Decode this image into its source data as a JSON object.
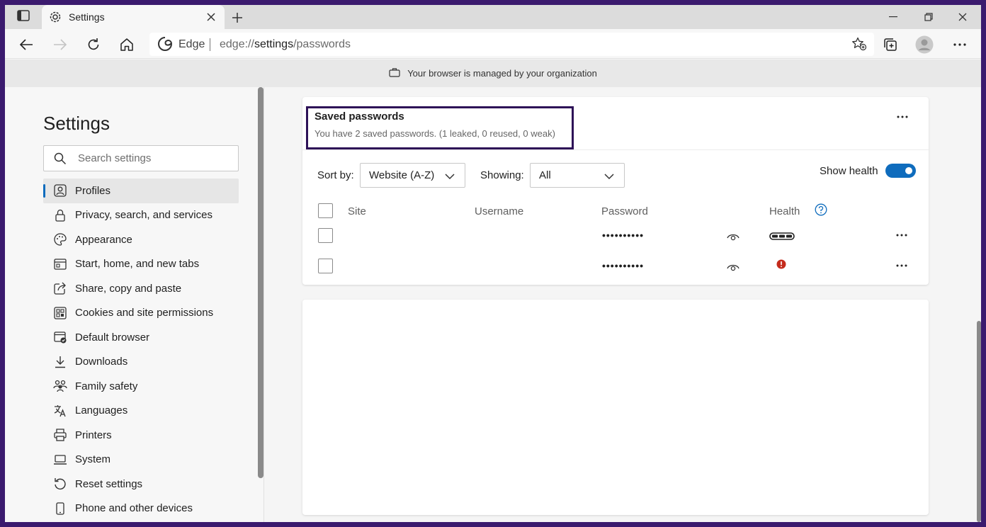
{
  "browser": {
    "tab_title": "Settings",
    "address_label": "Edge",
    "url_prefix": "edge://",
    "url_bold": "settings",
    "url_suffix": "/passwords",
    "managed_notice": "Your browser is managed by your organization"
  },
  "sidebar": {
    "title": "Settings",
    "search_placeholder": "Search settings",
    "items": [
      {
        "label": "Profiles",
        "icon": "profile-icon",
        "active": true
      },
      {
        "label": "Privacy, search, and services",
        "icon": "lock-icon"
      },
      {
        "label": "Appearance",
        "icon": "appearance-icon"
      },
      {
        "label": "Start, home, and new tabs",
        "icon": "start-page-icon"
      },
      {
        "label": "Share, copy and paste",
        "icon": "share-icon"
      },
      {
        "label": "Cookies and site permissions",
        "icon": "cookies-icon"
      },
      {
        "label": "Default browser",
        "icon": "default-browser-icon"
      },
      {
        "label": "Downloads",
        "icon": "download-icon"
      },
      {
        "label": "Family safety",
        "icon": "family-icon"
      },
      {
        "label": "Languages",
        "icon": "languages-icon"
      },
      {
        "label": "Printers",
        "icon": "printer-icon"
      },
      {
        "label": "System",
        "icon": "laptop-icon"
      },
      {
        "label": "Reset settings",
        "icon": "reset-icon"
      },
      {
        "label": "Phone and other devices",
        "icon": "phone-icon"
      }
    ]
  },
  "passwords": {
    "title": "Saved passwords",
    "subtitle": "You have 2 saved passwords. (1 leaked, 0 reused, 0 weak)",
    "sort_label": "Sort by:",
    "sort_value": "Website (A-Z)",
    "showing_label": "Showing:",
    "showing_value": "All",
    "show_health_label": "Show health",
    "show_health_on": true,
    "columns": {
      "site": "Site",
      "username": "Username",
      "password": "Password",
      "health": "Health"
    },
    "rows": [
      {
        "site": "",
        "username": "",
        "password": "••••••••••",
        "health": "strong"
      },
      {
        "site": "",
        "username": "",
        "password": "••••••••••",
        "health": "leaked"
      }
    ]
  },
  "colors": {
    "accent": "#0f6cbd",
    "leaked": "#c42b1c",
    "highlight_border": "#2d1157",
    "outer_frame": "#3b1a6e"
  }
}
